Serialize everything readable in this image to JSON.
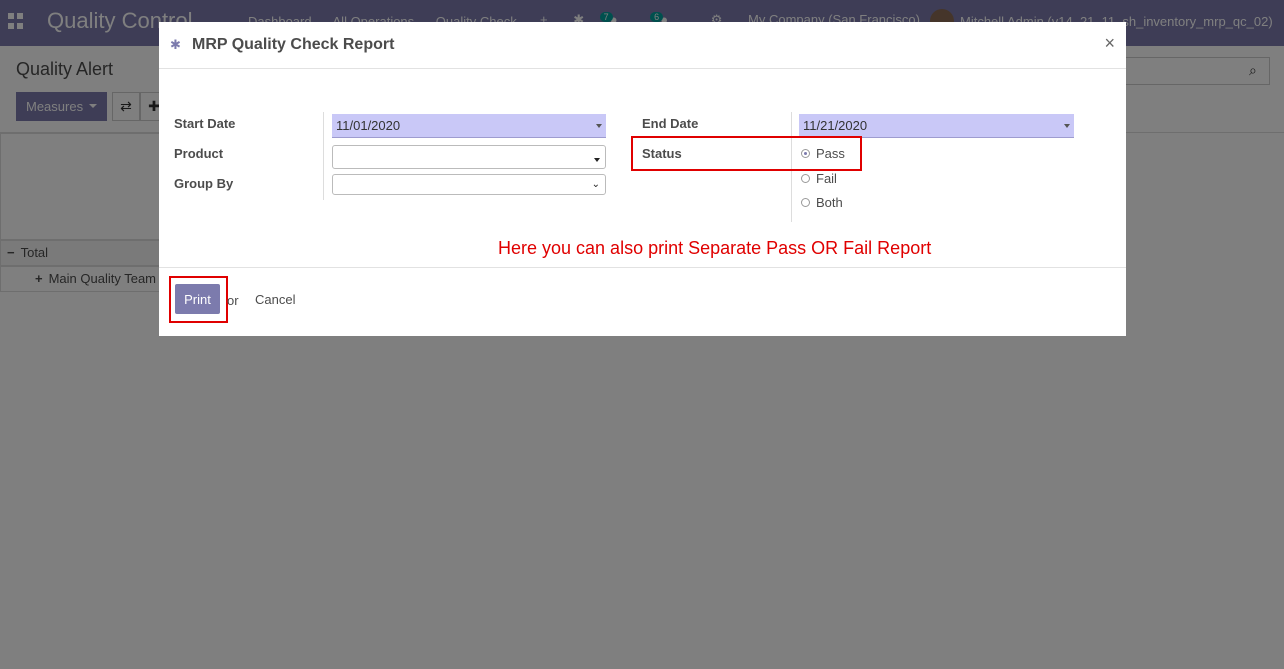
{
  "navbar": {
    "app_title": "Quality Control",
    "menu": [
      "Dashboard",
      "All Operations",
      "Quality Check"
    ],
    "plus_icon": "+",
    "chat_badge": "7",
    "activity_badge": "6",
    "company": "My Company (San Francisco)",
    "user": "Mitchell Admin (v14_21_11_sh_inventory_mrp_qc_02)"
  },
  "control_panel": {
    "breadcrumb": "Quality Alert",
    "measures_label": "Measures",
    "swap_icon": "⇄",
    "expand_icon": "✚"
  },
  "pivot": {
    "total_label": "Total",
    "total_sign": "−",
    "row_label": "Main Quality Team",
    "row_sign": "+"
  },
  "modal": {
    "title": "MRP Quality Check Report",
    "close_label": "×",
    "fields": {
      "start_date_label": "Start Date",
      "start_date_value": "11/01/2020",
      "product_label": "Product",
      "product_value": "",
      "group_by_label": "Group By",
      "group_by_value": "",
      "end_date_label": "End Date",
      "end_date_value": "11/21/2020",
      "status_label": "Status"
    },
    "status_options": [
      {
        "label": "Pass",
        "checked": true
      },
      {
        "label": "Fail",
        "checked": false
      },
      {
        "label": "Both",
        "checked": false
      }
    ],
    "annotation_text": "Here you can also print Separate Pass OR Fail Report",
    "annotation_color": "#e00000",
    "footer": {
      "print_label": "Print",
      "or_label": "or",
      "cancel_label": "Cancel"
    }
  },
  "colors": {
    "brand": "#7c7bad",
    "date_input_bg": "#c9c8f7"
  }
}
